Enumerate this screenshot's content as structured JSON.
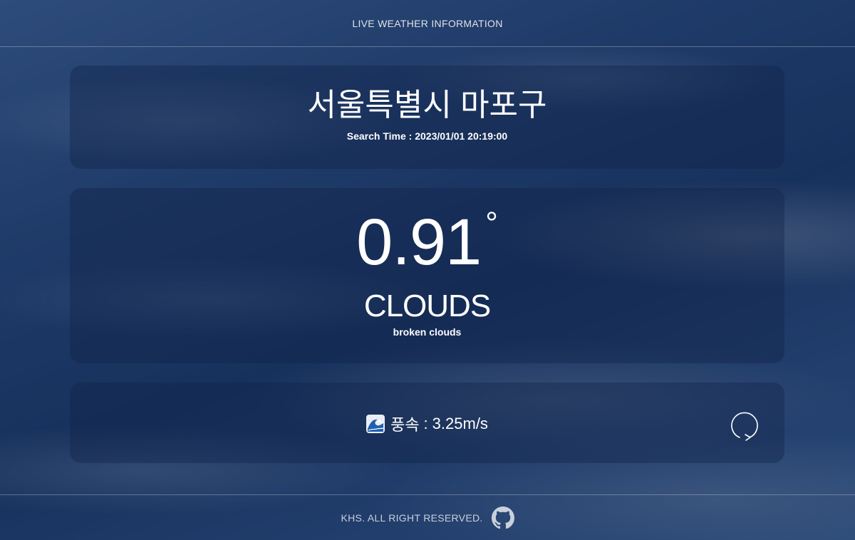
{
  "header": {
    "title": "LIVE WEATHER INFORMATION"
  },
  "location": {
    "name": "서울특별시 마포구",
    "search_time": "Search Time : 2023/01/01 20:19:00"
  },
  "weather": {
    "temperature": "0.91",
    "degree_symbol": "°",
    "condition": "CLOUDS",
    "description": "broken clouds"
  },
  "wind": {
    "icon": "wave-icon",
    "label": "풍속",
    "separator": ":",
    "value": "3.25m/s"
  },
  "refresh": {
    "icon": "refresh-icon"
  },
  "footer": {
    "text": "KHS. ALL RIGHT RESERVED.",
    "icon": "github-icon"
  },
  "colors": {
    "sky_dark": "#1d3a6a",
    "sky_light": "#3c5f93",
    "card_bg": "rgba(16,34,70,0.38)",
    "text": "#ffffff"
  }
}
